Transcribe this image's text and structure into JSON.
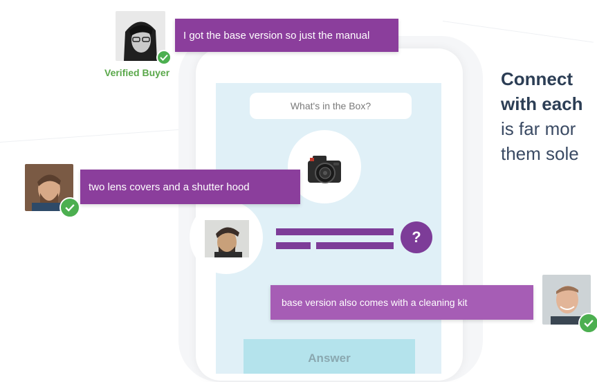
{
  "bubbles": {
    "top": "I got the base version so just the manual",
    "middle": "two lens covers and a shutter hood",
    "bottom": "base version also comes with a cleaning kit"
  },
  "verified_label": "Verified Buyer",
  "phone": {
    "question_placeholder": "What's in the Box?",
    "question_mark": "?",
    "answer_label": "Answer"
  },
  "headline": {
    "line1": "Connect",
    "line2": "with each",
    "line3": "is far mor",
    "line4": "them sole"
  },
  "colors": {
    "accent_purple": "#8b3e9c",
    "verified_green": "#4caf50",
    "screen_bg": "#e0f0f7",
    "answer_bg": "#b4e3ec",
    "headline": "#2c3e55"
  },
  "icons": [
    "camera-icon",
    "question-mark-icon",
    "checkmark-icon"
  ]
}
